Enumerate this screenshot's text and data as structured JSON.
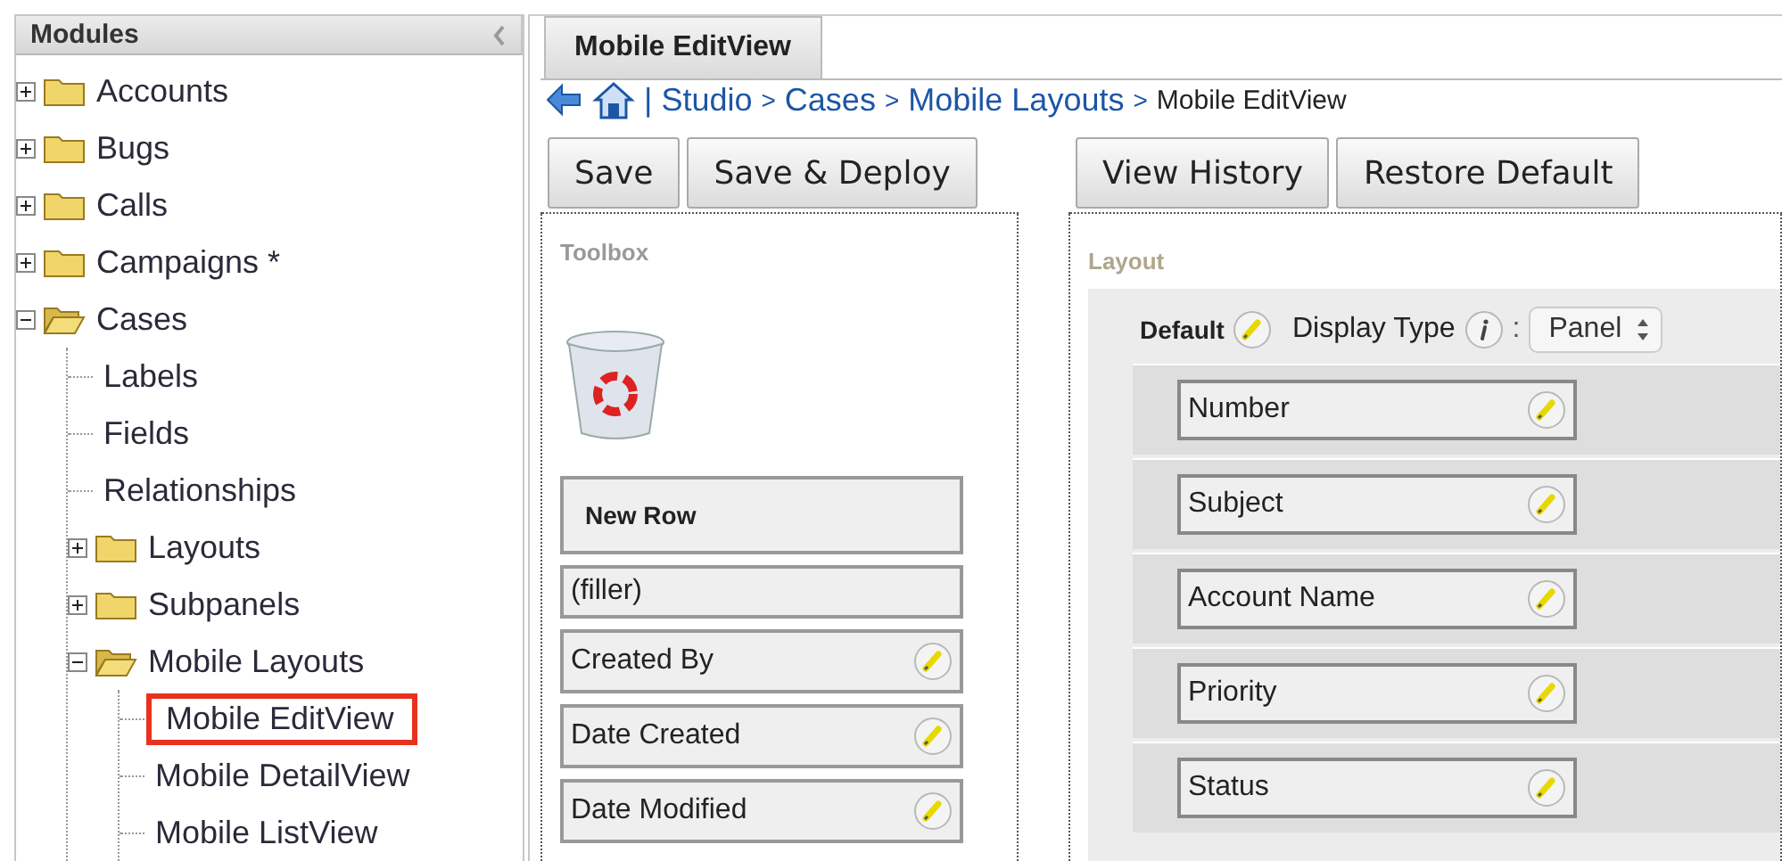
{
  "sidebar": {
    "title": "Modules",
    "tree": [
      {
        "label": "Accounts",
        "kind": "folder",
        "expanded": false,
        "selected": false
      },
      {
        "label": "Bugs",
        "kind": "folder",
        "expanded": false,
        "selected": false
      },
      {
        "label": "Calls",
        "kind": "folder",
        "expanded": false,
        "selected": false
      },
      {
        "label": "Campaigns *",
        "kind": "folder",
        "expanded": false,
        "selected": false
      },
      {
        "label": "Cases",
        "kind": "folder",
        "expanded": true,
        "selected": false,
        "children": [
          {
            "label": "Labels",
            "kind": "leaf",
            "selected": false
          },
          {
            "label": "Fields",
            "kind": "leaf",
            "selected": false
          },
          {
            "label": "Relationships",
            "kind": "leaf",
            "selected": false
          },
          {
            "label": "Layouts",
            "kind": "folder",
            "expanded": false,
            "selected": false
          },
          {
            "label": "Subpanels",
            "kind": "folder",
            "expanded": false,
            "selected": false
          },
          {
            "label": "Mobile Layouts",
            "kind": "folder",
            "expanded": true,
            "selected": false,
            "children": [
              {
                "label": "Mobile EditView",
                "kind": "leaf",
                "selected": true
              },
              {
                "label": "Mobile DetailView",
                "kind": "leaf",
                "selected": false
              },
              {
                "label": "Mobile ListView",
                "kind": "leaf",
                "selected": false
              }
            ]
          }
        ]
      }
    ]
  },
  "tabs": [
    {
      "label": "Mobile EditView",
      "selected": true
    }
  ],
  "breadcrumb": [
    {
      "kind": "divider",
      "text": "|"
    },
    {
      "kind": "link",
      "text": "Studio"
    },
    {
      "kind": "separator",
      "text": ">"
    },
    {
      "kind": "link",
      "text": "Cases"
    },
    {
      "kind": "separator",
      "text": ">"
    },
    {
      "kind": "link",
      "text": "Mobile Layouts"
    },
    {
      "kind": "separator",
      "text": ">"
    },
    {
      "kind": "current",
      "text": "Mobile EditView"
    }
  ],
  "left_buttons": [
    "Save",
    "Save & Deploy"
  ],
  "right_buttons": [
    "View History",
    "Restore Default"
  ],
  "toolbox": {
    "title": "Toolbox",
    "items": [
      {
        "kind": "row",
        "label": "New Row"
      },
      {
        "kind": "filler",
        "label": "(filler)"
      },
      {
        "kind": "field",
        "label": "Created By"
      },
      {
        "kind": "field",
        "label": "Date Created"
      },
      {
        "kind": "field",
        "label": "Date Modified"
      }
    ]
  },
  "layout": {
    "title": "Layout",
    "panel_name": "Default",
    "display_type_label": "Display Type",
    "colon": ":",
    "display_type": "Panel",
    "fields": [
      "Number",
      "Subject",
      "Account Name",
      "Priority",
      "Status"
    ]
  }
}
